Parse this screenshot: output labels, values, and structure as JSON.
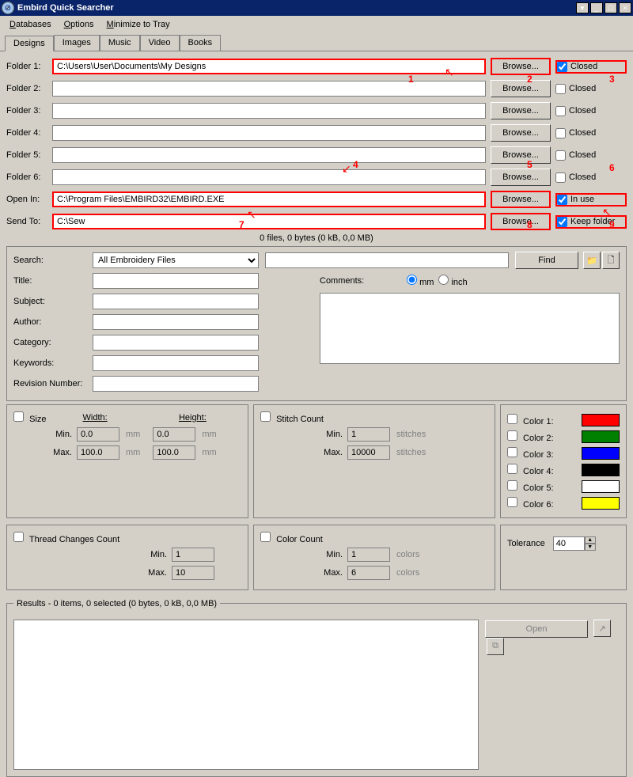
{
  "title": "Embird Quick Searcher",
  "menu": [
    "Databases",
    "Options",
    "Minimize to Tray"
  ],
  "tabs": [
    "Designs",
    "Images",
    "Music",
    "Video",
    "Books"
  ],
  "folders": [
    {
      "label": "Folder 1:",
      "value": "C:\\Users\\User\\Documents\\My Designs",
      "browse": "Browse...",
      "cb": "Closed",
      "checked": true,
      "hr": true,
      "hb": true,
      "hc": true
    },
    {
      "label": "Folder 2:",
      "value": "",
      "browse": "Browse...",
      "cb": "Closed",
      "checked": false
    },
    {
      "label": "Folder 3:",
      "value": "",
      "browse": "Browse...",
      "cb": "Closed",
      "checked": false
    },
    {
      "label": "Folder 4:",
      "value": "",
      "browse": "Browse...",
      "cb": "Closed",
      "checked": false
    },
    {
      "label": "Folder 5:",
      "value": "",
      "browse": "Browse...",
      "cb": "Closed",
      "checked": false
    },
    {
      "label": "Folder 6:",
      "value": "",
      "browse": "Browse...",
      "cb": "Closed",
      "checked": false
    },
    {
      "label": "Open In:",
      "value": "C:\\Program Files\\EMBIRD32\\EMBIRD.EXE",
      "browse": "Browse...",
      "cb": "In use",
      "checked": true,
      "hr": true,
      "hb": true,
      "hc": true
    },
    {
      "label": "Send To:",
      "value": "C:\\Sew",
      "browse": "Browse...",
      "cb": "Keep folder",
      "checked": true,
      "hr": true,
      "hb": true,
      "hc": true
    }
  ],
  "status": "0 files, 0 bytes (0 kB, 0,0 MB)",
  "search": {
    "label": "Search:",
    "type": "All Embroidery Files",
    "find": "Find",
    "title": "Title:",
    "subject": "Subject:",
    "author": "Author:",
    "category": "Category:",
    "keywords": "Keywords:",
    "revision": "Revision Number:",
    "comments": "Comments:",
    "mm": "mm",
    "inch": "inch"
  },
  "size": {
    "label": "Size",
    "width": "Width:",
    "height": "Height:",
    "min": "Min.",
    "max": "Max.",
    "wmin": "0.0",
    "wmax": "100.0",
    "hmin": "0.0",
    "hmax": "100.0",
    "unit": "mm"
  },
  "stitch": {
    "label": "Stitch Count",
    "min": "Min.",
    "max": "Max.",
    "vmin": "1",
    "vmax": "10000",
    "unit": "stitches"
  },
  "thread": {
    "label": "Thread Changes Count",
    "min": "Min.",
    "max": "Max.",
    "vmin": "1",
    "vmax": "10"
  },
  "colorcount": {
    "label": "Color Count",
    "min": "Min.",
    "max": "Max.",
    "vmin": "1",
    "vmax": "6",
    "unit": "colors"
  },
  "colors": [
    {
      "label": "Color 1:",
      "hex": "#ff0000"
    },
    {
      "label": "Color 2:",
      "hex": "#008000"
    },
    {
      "label": "Color 3:",
      "hex": "#0000ff"
    },
    {
      "label": "Color 4:",
      "hex": "#000000"
    },
    {
      "label": "Color 5:",
      "hex": "#ffffff"
    },
    {
      "label": "Color 6:",
      "hex": "#ffff00"
    }
  ],
  "tolerance": {
    "label": "Tolerance",
    "value": "40"
  },
  "results": {
    "legend": "Results - 0 items, 0 selected (0 bytes, 0 kB, 0,0 MB)",
    "open": "Open"
  },
  "annotations": [
    "1",
    "2",
    "3",
    "4",
    "5",
    "6",
    "7",
    "8",
    "9"
  ]
}
